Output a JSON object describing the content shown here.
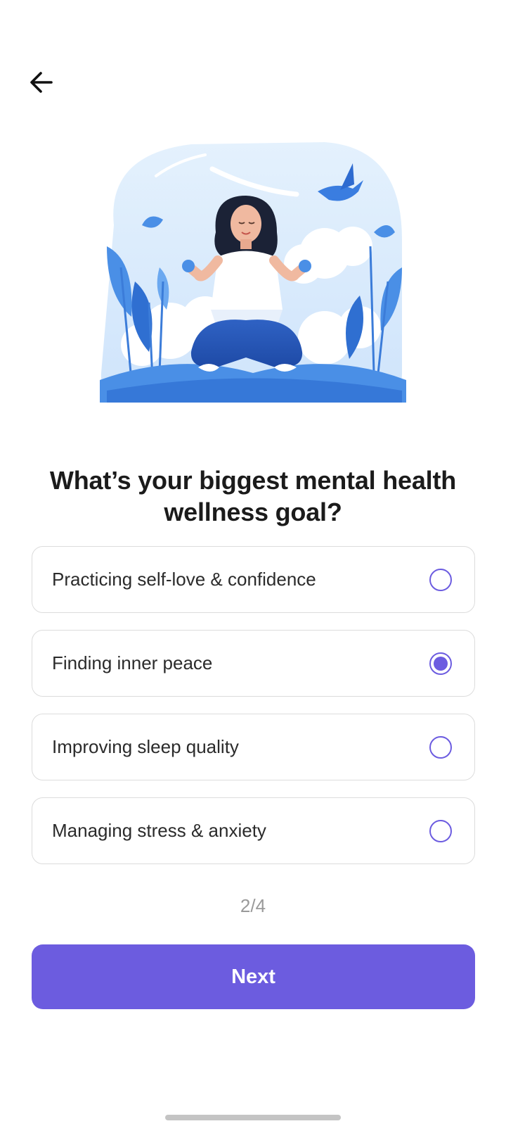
{
  "header": {
    "back_icon": "arrow-left-icon"
  },
  "hero": {
    "image": "meditating-woman-illustration"
  },
  "question": {
    "title": "What’s your biggest mental health wellness goal?"
  },
  "options": [
    {
      "label": "Practicing self-love & confidence",
      "selected": false
    },
    {
      "label": "Finding inner peace",
      "selected": true
    },
    {
      "label": "Improving sleep quality",
      "selected": false
    },
    {
      "label": "Managing stress & anxiety",
      "selected": false
    }
  ],
  "progress": {
    "text": "2/4"
  },
  "footer": {
    "next_label": "Next"
  },
  "colors": {
    "accent": "#6c5cdf",
    "border": "#dcdcdc",
    "muted": "#9a9a9a"
  }
}
